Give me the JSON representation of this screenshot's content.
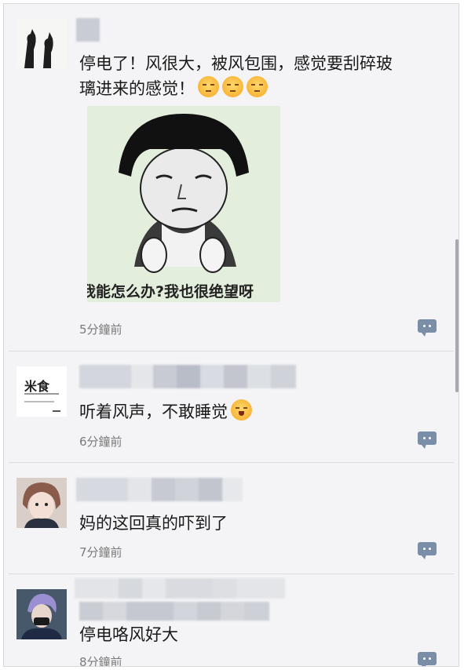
{
  "posts": [
    {
      "text_line1": "停电了！风很大，被风包围，感觉要刮碎玻",
      "text_line2": "璃进来的感觉！",
      "emojis": [
        "pout-face",
        "pout-face",
        "pout-face"
      ],
      "image_caption": "我能怎么办?我也很绝望呀",
      "time": "5分鐘前"
    },
    {
      "avatar_text": "米食",
      "text": "听着风声，不敢睡觉",
      "emojis": [
        "laughing-face"
      ],
      "time": "6分鐘前"
    },
    {
      "text": "妈的这回真的吓到了",
      "time": "7分鐘前"
    },
    {
      "text": "停电咯风好大",
      "time": "8分鐘前"
    }
  ],
  "icons": {
    "comment": "comment-bubble-icon"
  },
  "colors": {
    "comment_icon": "#7b8ea8",
    "background": "#f4f4f6"
  }
}
